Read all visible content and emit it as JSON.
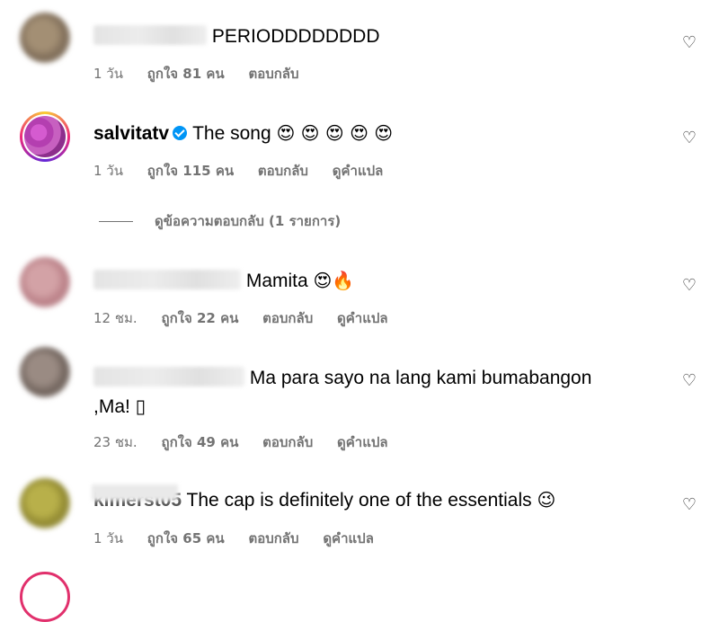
{
  "comments": [
    {
      "text": "PERIODDDDDDDD",
      "time": "1 วัน",
      "likes": "ถูกใจ 81 คน",
      "reply": "ตอบกลับ",
      "avatar_color": "#8a7a63"
    },
    {
      "username": "salvitatv",
      "text": "The song",
      "emoji": "😍 😍 😍 😍 😍",
      "time": "1 วัน",
      "likes": "ถูกใจ 115 คน",
      "reply": "ตอบกลับ",
      "translate": "ดูคำแปล",
      "view_replies": "ดูข้อความตอบกลับ (1 รายการ)"
    },
    {
      "text": "Mamita",
      "emoji": "😍🔥",
      "time": "12 ชม.",
      "likes": "ถูกใจ 22 คน",
      "reply": "ตอบกลับ",
      "translate": "ดูคำแปล",
      "avatar_color": "#c98a8f"
    },
    {
      "text": "Ma para sayo na lang kami bumabangon",
      "text2": ",Ma! ▯",
      "time": "23 ชม.",
      "likes": "ถูกใจ 49 คน",
      "reply": "ตอบกลับ",
      "translate": "ดูคำแปล",
      "avatar_color": "#7d6f66"
    },
    {
      "username_partial": "kimerst05",
      "text": "The cap is definitely one of the essentials",
      "emoji": "😉",
      "time": "1 วัน",
      "likes": "ถูกใจ 65 คน",
      "reply": "ตอบกลับ",
      "translate": "ดูคำแปล",
      "avatar_color": "#a39a3a"
    }
  ],
  "icons": {
    "like": "heart-outline-icon",
    "verified": "verified-badge-icon"
  },
  "heart_glyph": "♡"
}
